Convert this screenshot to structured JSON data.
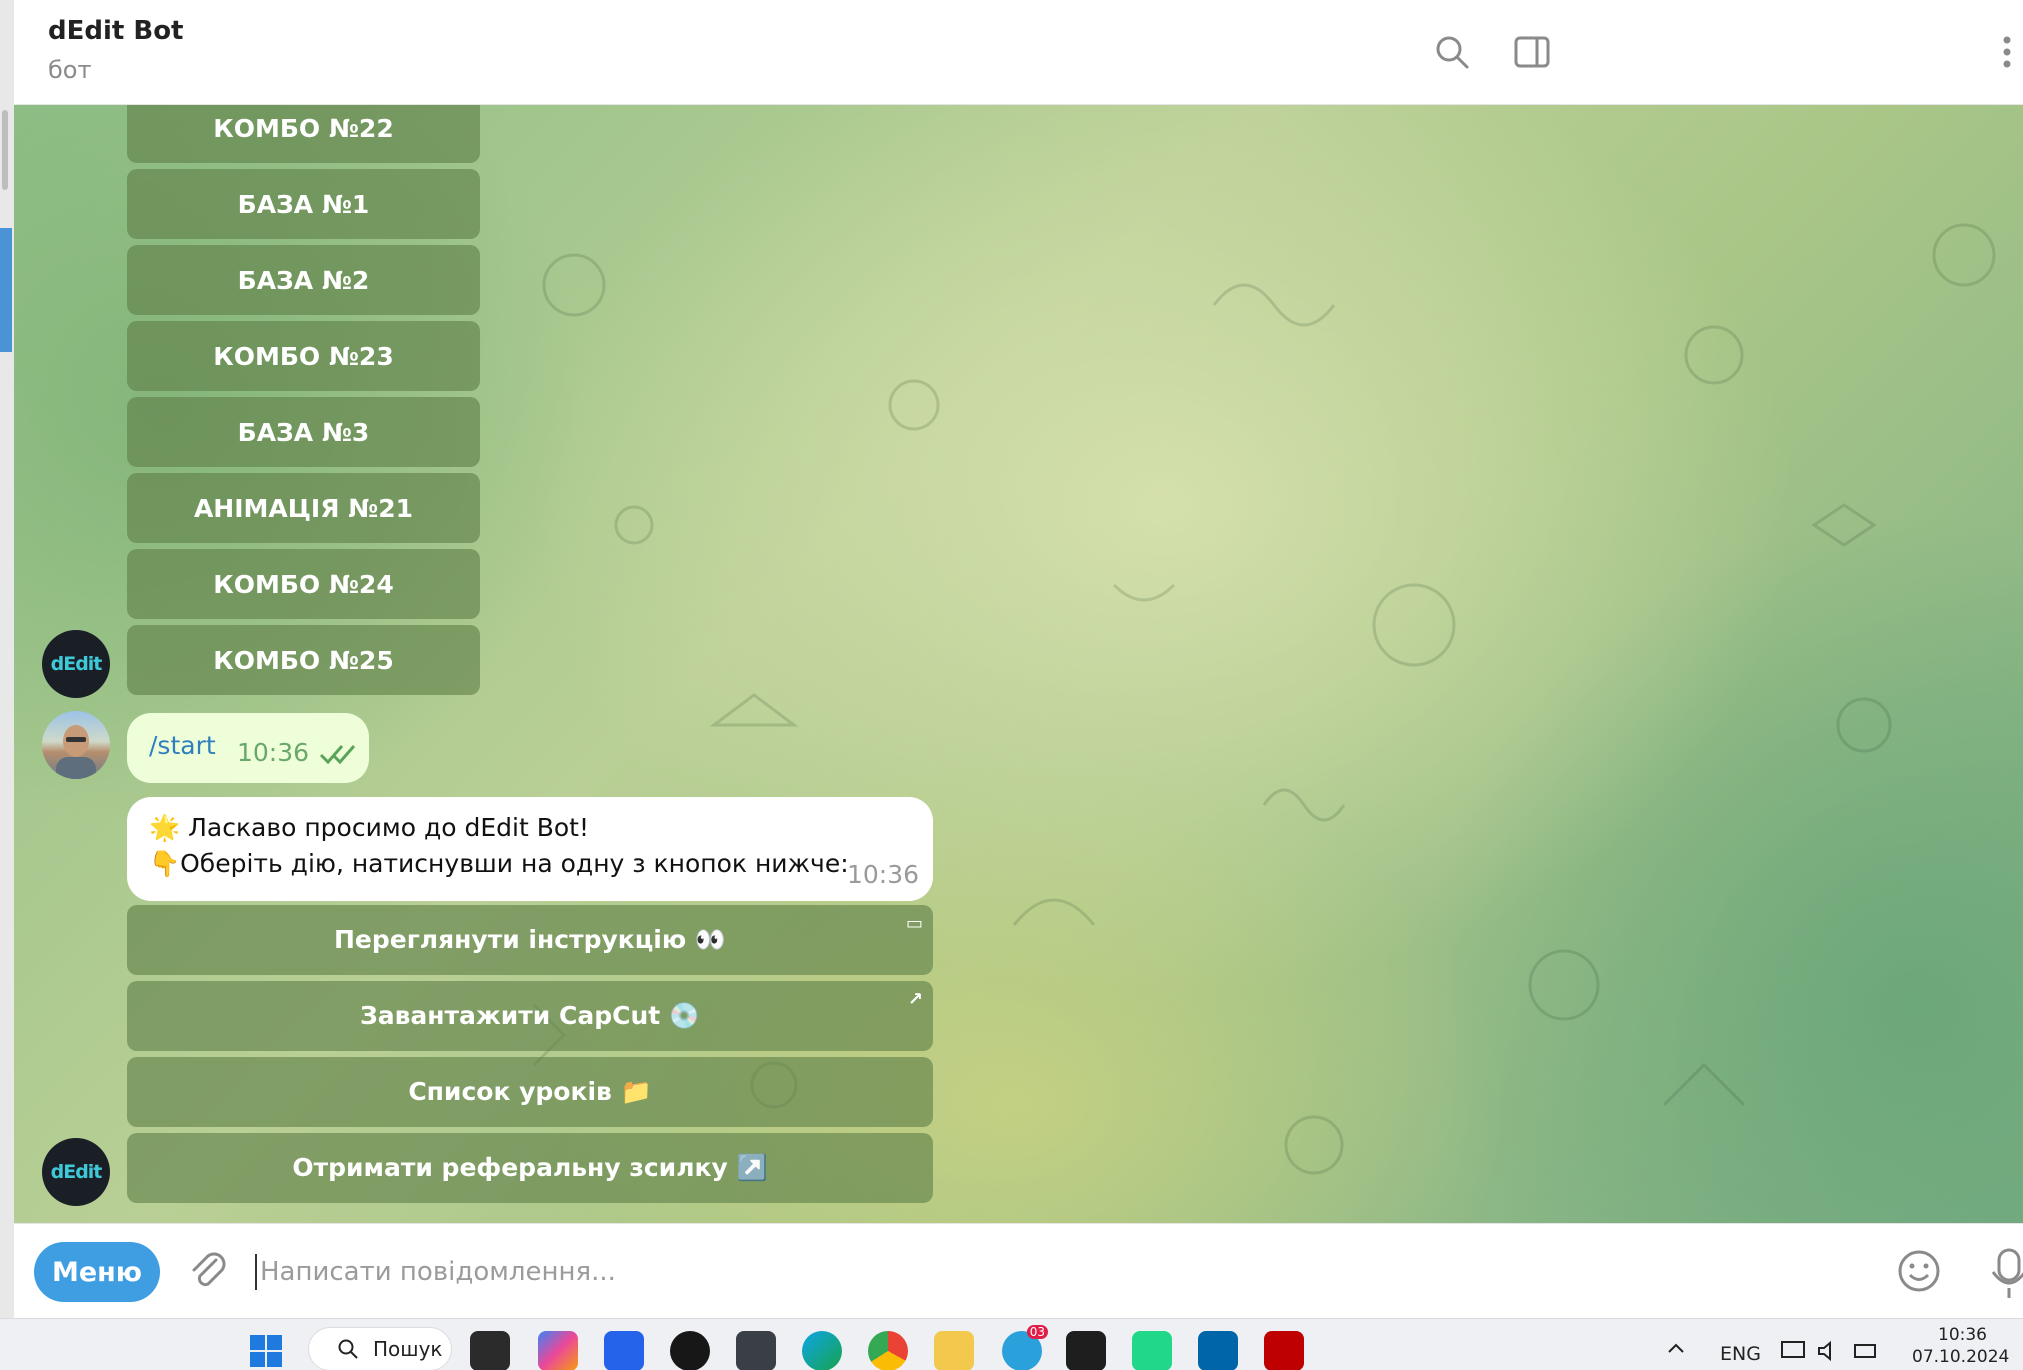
{
  "header": {
    "title": "dEdit Bot",
    "subtitle": "бот",
    "icons": [
      "search-icon",
      "sidebar-toggle-icon",
      "more-vert-icon"
    ]
  },
  "chat": {
    "bot_avatar_text": "dEdit",
    "keyboard_buttons_top": [
      "КОМБО №22",
      "БАЗА №1",
      "БАЗА №2",
      "КОМБО №23",
      "БАЗА №3",
      "АНІМАЦІЯ №21",
      "КОМБО №24",
      "КОМБО №25"
    ],
    "outgoing_message": {
      "text": "/start",
      "time": "10:36",
      "status": "read"
    },
    "incoming_message": {
      "line1": "🌟 Ласкаво просимо до dEdit Bot!",
      "line2": "👇Оберіть дію, натиснувши на одну з кнопок нижче:",
      "time": "10:36"
    },
    "keyboard_buttons_bottom": [
      {
        "label": "Переглянути інструкцію 👀",
        "corner": "▭"
      },
      {
        "label": "Завантажити CapCut 💿",
        "corner": "↗"
      },
      {
        "label": "Список уроків 📁",
        "corner": ""
      },
      {
        "label": "Отримати реферальну зсилку ↗️",
        "corner": ""
      }
    ]
  },
  "input": {
    "menu_label": "Меню",
    "placeholder": "Написати повідомлення..."
  },
  "taskbar": {
    "search_label": "Пошук",
    "telegram_badge": "03",
    "lang": "ENG",
    "time": "10:36",
    "date": "07.10.2024"
  }
}
